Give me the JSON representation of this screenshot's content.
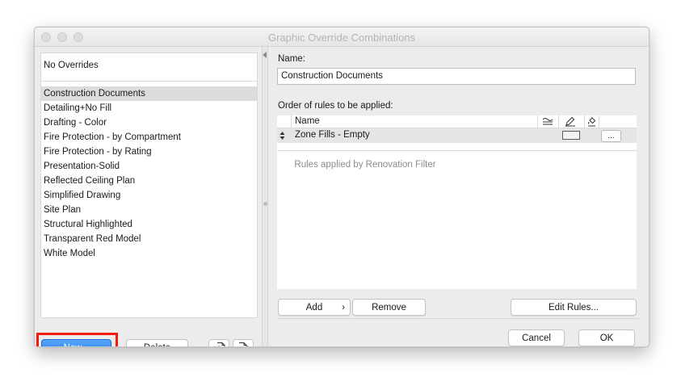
{
  "window": {
    "title": "Graphic Override Combinations"
  },
  "list": {
    "no_overrides": "No Overrides",
    "items": [
      "Construction Documents",
      "Detailing+No Fill",
      "Drafting - Color",
      "Fire Protection - by Compartment",
      "Fire Protection - by Rating",
      "Presentation-Solid",
      "Reflected Ceiling Plan",
      "Simplified Drawing",
      "Site Plan",
      "Structural Highlighted",
      "Transparent Red Model",
      "White Model"
    ],
    "selected": "Construction Documents"
  },
  "left_buttons": {
    "new": "New...",
    "delete": "Delete"
  },
  "icons": {
    "import": "import-icon",
    "export": "export-icon",
    "collapse": "triangle-left-icon",
    "reorder": "up-down-arrows-icon",
    "surface_column": "surface-icon",
    "pen_column": "pen-icon",
    "fill_column": "fill-bucket-icon"
  },
  "details": {
    "name_label": "Name:",
    "name_value": "Construction Documents",
    "order_label": "Order of rules to be applied:",
    "table_header_name": "Name",
    "rules": [
      {
        "name": "Zone Fills - Empty"
      }
    ],
    "more_button": "...",
    "renovation_text": "Rules applied by Renovation Filter",
    "add": "Add",
    "add_arrow": "›",
    "remove": "Remove",
    "edit_rules": "Edit Rules..."
  },
  "footer": {
    "cancel": "Cancel",
    "ok": "OK"
  },
  "colors": {
    "primary_button": "#1a76f2",
    "highlight_border": "#f21a0a",
    "selection_bg": "#dcdcdc"
  }
}
